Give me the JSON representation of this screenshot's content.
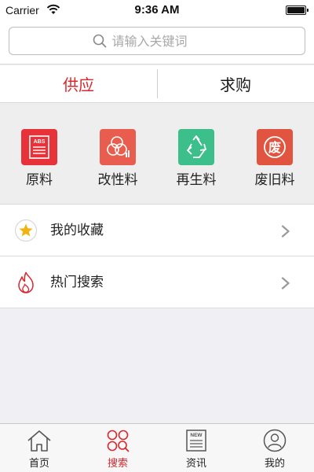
{
  "status_bar": {
    "carrier": "Carrier",
    "time": "9:36 AM",
    "battery_level": 1.0
  },
  "search": {
    "placeholder": "请输入关键词"
  },
  "tabs": [
    {
      "label": "供应",
      "active": true
    },
    {
      "label": "求购",
      "active": false
    }
  ],
  "categories": [
    {
      "label": "原料",
      "icon": "abs-document-icon",
      "color": "#e8323a",
      "badge": "ABS"
    },
    {
      "label": "改性料",
      "icon": "modified-material-icon",
      "color": "#e85d4e"
    },
    {
      "label": "再生料",
      "icon": "recycle-icon",
      "color": "#3cbf8a"
    },
    {
      "label": "废旧料",
      "icon": "waste-icon",
      "color": "#e05440",
      "badge": "废"
    }
  ],
  "list": [
    {
      "label": "我的收藏",
      "icon": "star-icon"
    },
    {
      "label": "热门搜索",
      "icon": "flame-icon"
    }
  ],
  "tabbar": {
    "items": [
      {
        "label": "首页",
        "icon": "home-icon",
        "active": false
      },
      {
        "label": "搜索",
        "icon": "search-grid-icon",
        "active": true
      },
      {
        "label": "资讯",
        "icon": "news-icon",
        "active": false,
        "badge": "NEW"
      },
      {
        "label": "我的",
        "icon": "user-icon",
        "active": false
      }
    ]
  },
  "colors": {
    "accent": "#d8282e",
    "star": "#f2b20f",
    "background": "#f0eff4"
  }
}
